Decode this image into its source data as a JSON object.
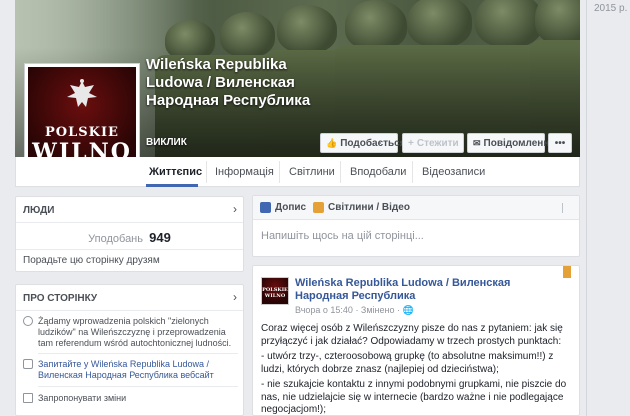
{
  "timeline": {
    "year": "2015 р."
  },
  "cover": {
    "title": "Wileńska Republika Ludowa / Виленская Народная Республика",
    "category": "ВИКЛИК",
    "buttons": {
      "like": "Подобається!",
      "follow": "Стежити",
      "message": "Повідомлення",
      "more": "•••"
    }
  },
  "profile_picture": {
    "line1": "POLSKIE",
    "line2": "WILNO"
  },
  "nav": {
    "tabs": [
      "Життєпис",
      "Інформація",
      "Світлини",
      "Вподобали",
      "Відеозаписи"
    ],
    "active_index": 0
  },
  "likes_card": {
    "title": "ЛЮДИ",
    "likes_label": "Уподобань",
    "likes_count": "949",
    "invite_text": "Порадьте цю сторінку друзям"
  },
  "about_card": {
    "title": "ПРО СТОРІНКУ",
    "description": "Żądamy wprowadzenia polskich \"zielonych ludzików\" na Wileńszczyznę i przeprowadzenia tam referendum wśród autochtonicznej ludności.",
    "website_link": "Запитайте у Wileńska Republika Ludowa / Виленская Народная Республика вебсайт",
    "suggest_edits": "Запропонувати зміни"
  },
  "composer": {
    "tab_post": "Допис",
    "tab_photo": "Світлини / Відео",
    "placeholder": "Напишіть щось на цій сторінці..."
  },
  "post": {
    "author": "Wileńska Republika Ludowa / Виленская Народная Республика",
    "avatar_text": "POLSKIE WILNO",
    "meta": "Вчора о 15:40 · Змінено · 🌐",
    "paragraphs": [
      "Coraz więcej osób z Wileńszczyzny pisze do nas z pytaniem: jak się przyłączyć i jak działać? Odpowiadamy w trzech prostych punktach:",
      "- utwórz trzy-, czteroosobową grupkę (to absolutne maksimum!!) z ludzi, których dobrze znasz (najlepiej od dzieciństwa);",
      "- nie szukajcie kontaktu z innymi podobnymi grupkami, nie piszcie do nas, nie udzielajcie się w internecie (bardzo ważne i nie podlegające negocjacjom!);"
    ]
  }
}
